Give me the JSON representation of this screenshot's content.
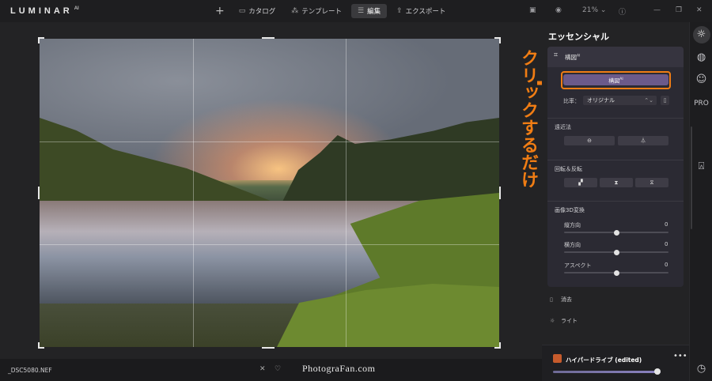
{
  "app": {
    "logo": "LUMINAR",
    "logo_sup": "AI"
  },
  "topbar": {
    "add_label": "+",
    "tabs": [
      {
        "label": "カタログ",
        "icon": "folder-icon"
      },
      {
        "label": "テンプレート",
        "icon": "wand-icon"
      },
      {
        "label": "編集",
        "icon": "sliders-icon",
        "active": true
      },
      {
        "label": "エクスポート",
        "icon": "export-icon"
      }
    ],
    "zoom": "21%"
  },
  "canvas": {
    "filename": "_DSC5080.NEF",
    "watermark": "PhotograFan.com"
  },
  "annotation": {
    "text": "クリックするだけ",
    "color": "#f07d14"
  },
  "panel": {
    "title": "エッセンシャル",
    "composition": {
      "header": "構図",
      "header_sup": "AI",
      "ai_button": "構図",
      "ai_button_sup": "AI",
      "ratio_label": "比率：",
      "ratio_value": "オリジナル"
    },
    "perspective": {
      "label": "遠近法"
    },
    "rotate_flip": {
      "label": "回転＆反転"
    },
    "transform3d": {
      "label": "画像3D変換",
      "sliders": [
        {
          "label": "縦方向",
          "value": "0",
          "level": 0.5
        },
        {
          "label": "横方向",
          "value": "0",
          "level": 0.5
        },
        {
          "label": "アスペクト",
          "value": "0",
          "level": 0.5
        }
      ]
    },
    "collapsed_tools": [
      {
        "label": "消去",
        "icon": "eraser-icon"
      },
      {
        "label": "ライト",
        "icon": "sun-icon"
      }
    ],
    "hyperdrive": {
      "label": "ハイパードライブ (edited)",
      "more": "•••",
      "level": 0.97
    }
  },
  "iconbar": [
    {
      "name": "essentials-icon",
      "glyph": "☀"
    },
    {
      "name": "creative-icon",
      "glyph": "🎨"
    },
    {
      "name": "portrait-icon",
      "glyph": "☺"
    },
    {
      "name": "pro-icon",
      "glyph": "PRO"
    },
    {
      "name": "local-masking-icon",
      "glyph": "⬚"
    },
    {
      "name": "history-icon",
      "glyph": "🕓"
    }
  ]
}
